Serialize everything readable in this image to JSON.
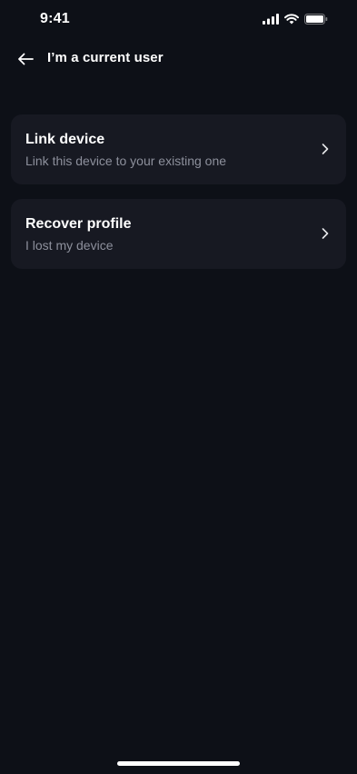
{
  "status_bar": {
    "time": "9:41",
    "icons": [
      "cellular-signal-icon",
      "wifi-icon",
      "battery-icon"
    ]
  },
  "header": {
    "back_icon": "arrow-left-icon",
    "title": "I’m a current user"
  },
  "options": [
    {
      "title": "Link device",
      "subtitle": "Link this device to your existing one",
      "icon": "chevron-right-icon"
    },
    {
      "title": "Recover profile",
      "subtitle": "I lost my device",
      "icon": "chevron-right-icon"
    }
  ],
  "colors": {
    "background": "#0d1017",
    "card_background": "#171922",
    "primary_text": "#ffffff",
    "secondary_text": "#8d909c"
  }
}
